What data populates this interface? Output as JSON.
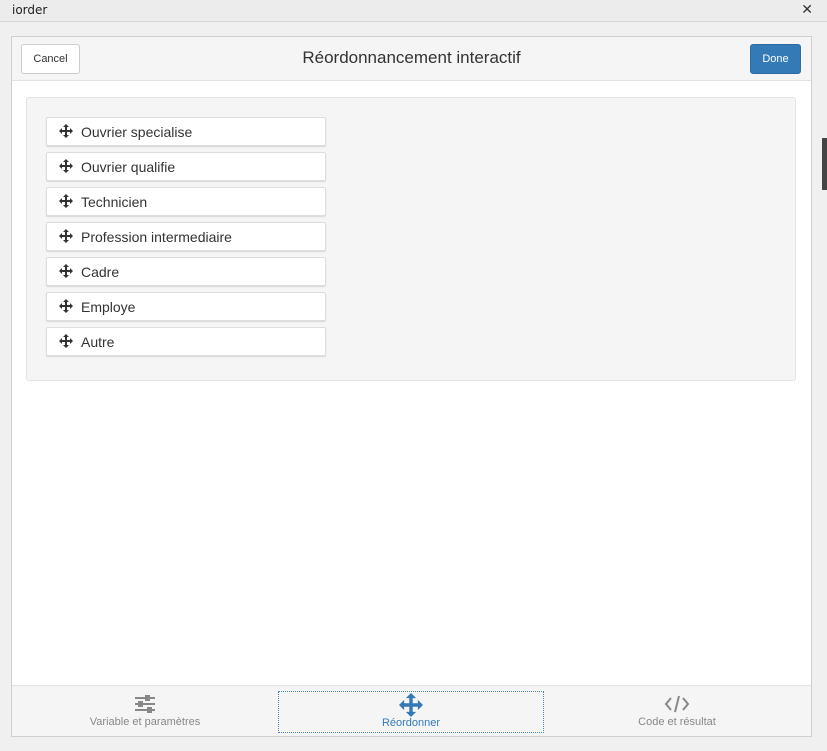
{
  "window": {
    "title": "iorder",
    "close_glyph": "✕"
  },
  "gadget": {
    "title": "Réordonnancement interactif",
    "cancel_label": "Cancel",
    "done_label": "Done",
    "accent_color": "#337ab7"
  },
  "sortable": {
    "items": [
      {
        "label": "Ouvrier specialise",
        "icon": "move-icon"
      },
      {
        "label": "Ouvrier qualifie",
        "icon": "move-icon"
      },
      {
        "label": "Technicien",
        "icon": "move-icon"
      },
      {
        "label": "Profession intermediaire",
        "icon": "move-icon"
      },
      {
        "label": "Cadre",
        "icon": "move-icon"
      },
      {
        "label": "Employe",
        "icon": "move-icon"
      },
      {
        "label": "Autre",
        "icon": "move-icon"
      }
    ]
  },
  "tabs": [
    {
      "label": "Variable et paramètres",
      "icon": "sliders-icon",
      "active": false
    },
    {
      "label": "Réordonner",
      "icon": "move-arrows-icon",
      "active": true
    },
    {
      "label": "Code et résultat",
      "icon": "code-icon",
      "active": false
    }
  ]
}
